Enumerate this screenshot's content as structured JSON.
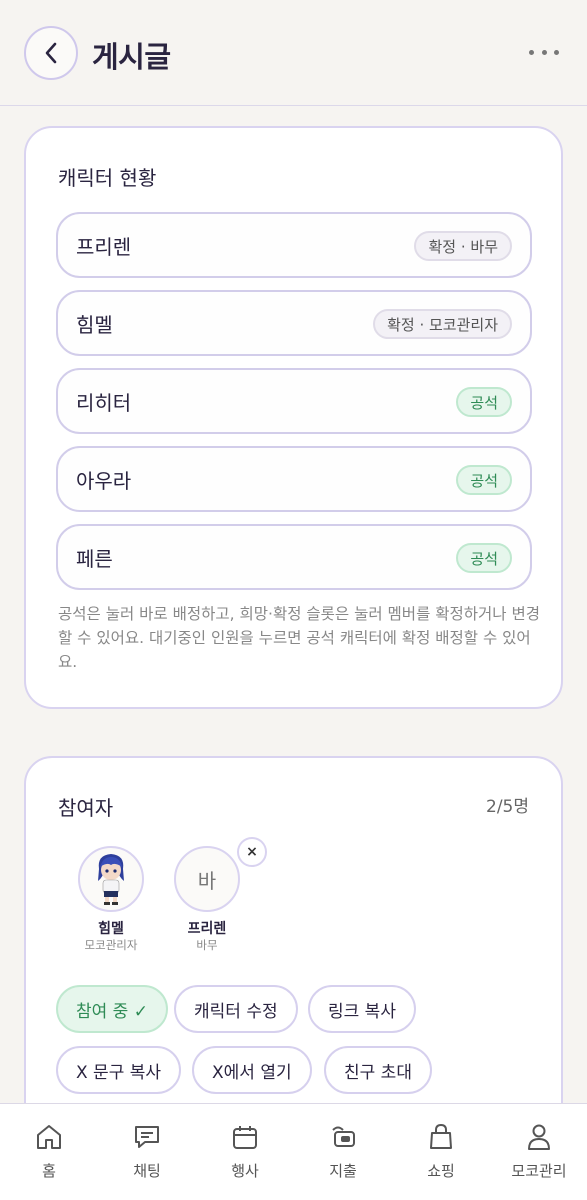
{
  "header": {
    "title": "게시글"
  },
  "characters": {
    "title": "캐릭터 현황",
    "rows": [
      {
        "name": "프리렌",
        "badge": "확정 · 바무",
        "status": "confirmed"
      },
      {
        "name": "힘멜",
        "badge": "확정 · 모코관리자",
        "status": "confirmed"
      },
      {
        "name": "리히터",
        "badge": "공석",
        "status": "vacant"
      },
      {
        "name": "아우라",
        "badge": "공석",
        "status": "vacant"
      },
      {
        "name": "페른",
        "badge": "공석",
        "status": "vacant"
      }
    ],
    "help": "공석은 눌러 바로 배정하고, 희망·확정 슬롯은 눌러 멤버를 확정하거나 변경할 수 있어요. 대기중인 인원을 누르면 공석 캐릭터에 확정 배정할 수 있어요."
  },
  "participants": {
    "title": "참여자",
    "count": "2/5명",
    "members": [
      {
        "name": "힘멜",
        "sub": "모코관리자",
        "avatar": "character-image"
      },
      {
        "name": "프리렌",
        "sub": "바무",
        "avatar_letter": "바",
        "remove": "×"
      }
    ],
    "actions": [
      {
        "label": "참여 중 ✓"
      },
      {
        "label": "캐릭터 수정"
      },
      {
        "label": "링크 복사"
      },
      {
        "label": "X 문구 복사"
      },
      {
        "label": "X에서 열기"
      },
      {
        "label": "친구 초대"
      }
    ]
  },
  "nav": {
    "items": [
      {
        "label": "홈",
        "icon": "home-icon"
      },
      {
        "label": "채팅",
        "icon": "chat-icon"
      },
      {
        "label": "행사",
        "icon": "calendar-icon"
      },
      {
        "label": "지출",
        "icon": "wallet-icon"
      },
      {
        "label": "쇼핑",
        "icon": "shopping-bag-icon"
      },
      {
        "label": "모코관리",
        "icon": "person-icon"
      }
    ]
  },
  "colors": {
    "accent": "#d9d3f0",
    "vacant_green": "#2e8b55",
    "text": "#2a2440"
  }
}
